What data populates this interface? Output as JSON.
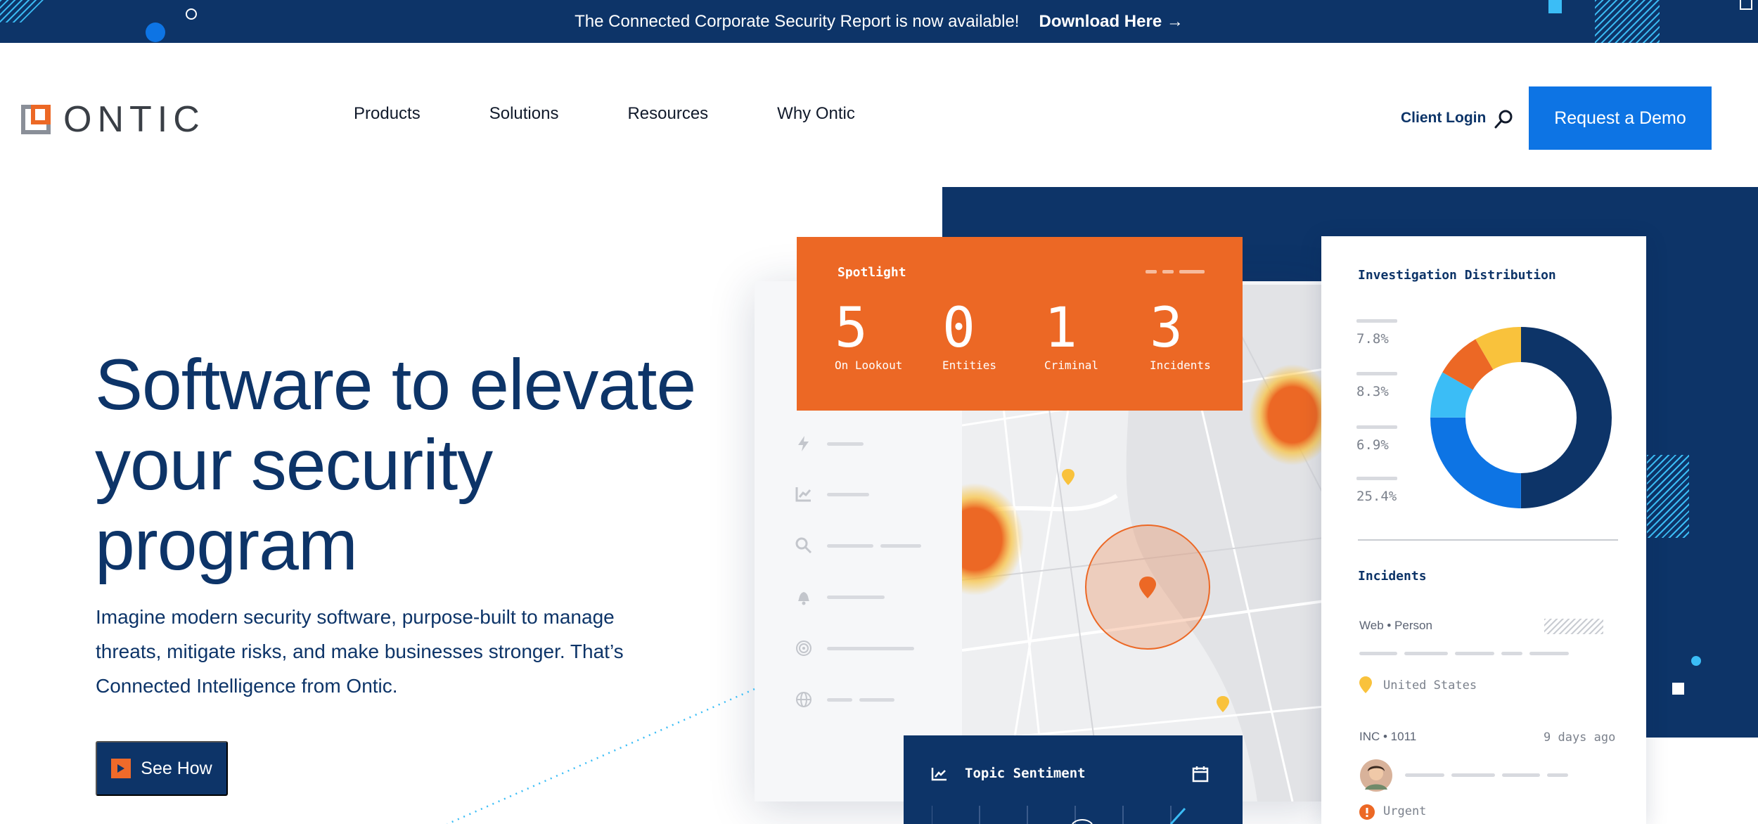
{
  "announcement": {
    "text": "The Connected Corporate Security Report is now available!",
    "cta": "Download Here →"
  },
  "header": {
    "logo_text": "ONTIC",
    "nav": [
      "Products",
      "Solutions",
      "Resources",
      "Why Ontic"
    ],
    "client_login": "Client Login",
    "demo_button": "Request a Demo"
  },
  "hero": {
    "title_lines": [
      "Software to elevate",
      "your security",
      "program"
    ],
    "subtitle_lines": [
      "Imagine modern security software, purpose-built to manage",
      "threats, mitigate risks, and make businesses stronger. That’s",
      "Connected Intelligence from Ontic."
    ],
    "cta": "See How"
  },
  "spotlight": {
    "label": "Spotlight",
    "stats": [
      {
        "value": "5",
        "label": "On Lookout"
      },
      {
        "value": "0",
        "label": "Entities"
      },
      {
        "value": "1",
        "label": "Criminal"
      },
      {
        "value": "3",
        "label": "Incidents"
      }
    ]
  },
  "distribution": {
    "title": "Investigation Distribution",
    "percentages": [
      "7.8%",
      "8.3%",
      "6.9%",
      "25.4%"
    ],
    "colors": {
      "navy": "#0d3468",
      "blue": "#0d74e4",
      "sky": "#3bbdf6",
      "orange": "#ec6825",
      "yellow": "#f9c23c"
    }
  },
  "incidents": {
    "title": "Incidents",
    "item1_type": "Web • Person",
    "item1_location": "United States",
    "item2_id": "INC • 1011",
    "item2_time": "9 days ago",
    "item2_status": "Urgent"
  },
  "topic": {
    "title": "Topic Sentiment"
  },
  "icons": [
    "bolt-icon",
    "chart-icon",
    "search-icon",
    "bell-icon",
    "fingerprint-icon",
    "globe-icon",
    "calendar-icon",
    "location-pin-icon",
    "warning-icon",
    "play-icon"
  ]
}
